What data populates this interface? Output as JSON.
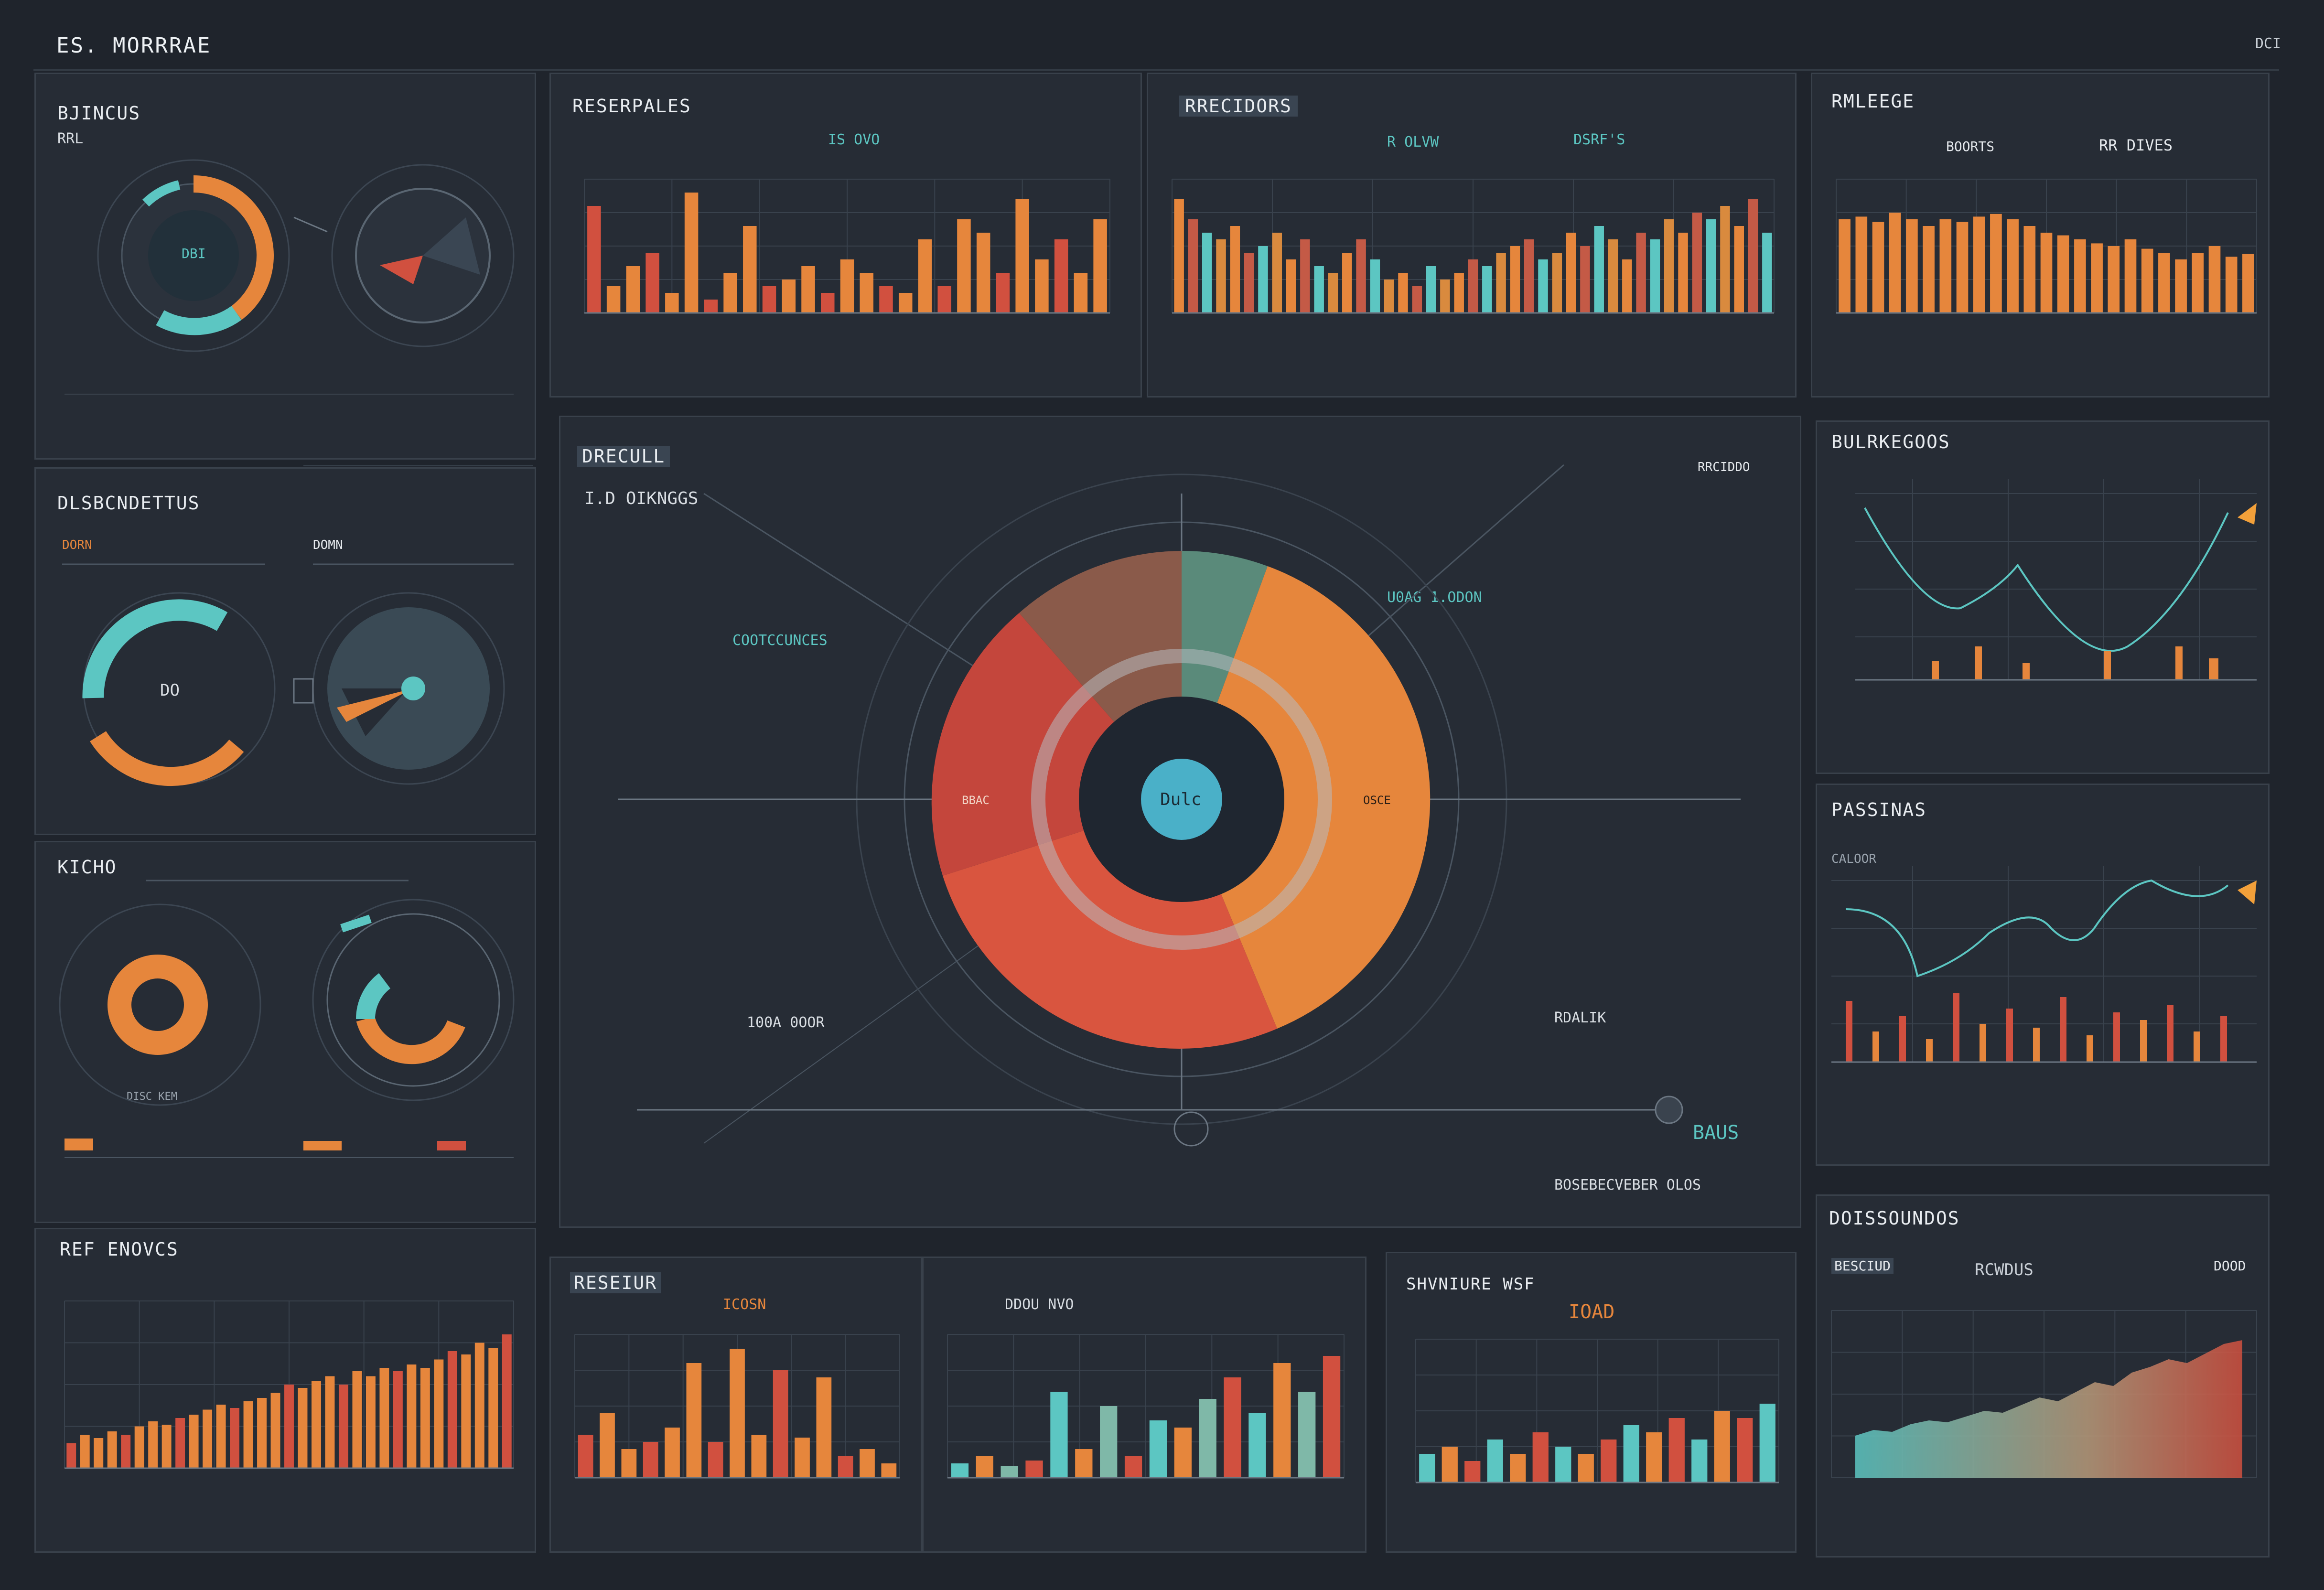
{
  "app": {
    "title": "ES. MORRRAE",
    "top_right": "DCI",
    "colors": {
      "bg": "#1f242c",
      "panel": "#262c35",
      "teal": "#5cc6c2",
      "orange": "#e6863c",
      "red": "#d1503f",
      "accent": "#f2a03a"
    }
  },
  "left": {
    "p1": {
      "title": "BJINCUS",
      "sub": "RRL"
    },
    "p2": {
      "title": "DLSBCNDETTUS",
      "row1": "DORN",
      "row2": "DOMN",
      "center": "DO"
    },
    "p3": {
      "title": "KICHO",
      "footer": "DISC KEM"
    },
    "p4": {
      "title": "REF ENOVCS"
    }
  },
  "top": {
    "p1": {
      "title": "RESERPALES",
      "stat": "IS OVO"
    },
    "p2": {
      "title": "RRECIDORS",
      "stat1": "R OLVW",
      "stat2": "DSRF'S"
    },
    "p3": {
      "title": "RMLEEGE",
      "stat1": "BOORTS",
      "stat2": "RR DIVES"
    }
  },
  "center": {
    "title": "DRECULL",
    "subtitle": "I.D OIKNGGS",
    "corner": "RRCIDDO",
    "hub": "Dulc",
    "label_left": "COOTCCUNCES",
    "label_right": "U0AG 1.ODON",
    "label_bl": "100A 0OOR",
    "label_br": "RDALIK",
    "slice_l": "BBAC",
    "slice_r": "OSCE",
    "footer": "BOSEBECVEBER OLOS",
    "badge": "BAUS"
  },
  "right": {
    "p1": {
      "title": "BULRKEGOOS"
    },
    "p2": {
      "title": "PASSINAS",
      "sub": "CALOOR"
    },
    "p3": {
      "title": "DOISSOUNDOS",
      "sub1": "BESCIUD",
      "sub2": "RCWDUS",
      "sub3": "DOOD"
    }
  },
  "bottom": {
    "p1": {
      "title": "RESEIUR",
      "stat": "ICOSN"
    },
    "p2": {
      "stat": "DDOU NVO"
    },
    "p3": {
      "title": "SHVNIURE WSF",
      "stat": "IOAD"
    }
  },
  "charts": {
    "top1_values": [
      80,
      20,
      35,
      45,
      15,
      90,
      10,
      30,
      65,
      20,
      25,
      35,
      15,
      40,
      30,
      20,
      15,
      55,
      20,
      70,
      60,
      30,
      85,
      40,
      55,
      30,
      70
    ],
    "top2_values": [
      85,
      70,
      60,
      55,
      65,
      45,
      50,
      60,
      40,
      55,
      35,
      30,
      45,
      55,
      40,
      25,
      30,
      20,
      35,
      25,
      30,
      40,
      35,
      45,
      50,
      55,
      40,
      45,
      60,
      50,
      65,
      55,
      40,
      60,
      55,
      70,
      60,
      75,
      70,
      80,
      65,
      85,
      60
    ],
    "top3_values": [
      70,
      72,
      68,
      75,
      70,
      65,
      70,
      68,
      72,
      74,
      70,
      65,
      60,
      58,
      55,
      52,
      50,
      55,
      48,
      45,
      40,
      45,
      50,
      42,
      44
    ],
    "bl_values": [
      15,
      20,
      18,
      22,
      20,
      25,
      28,
      26,
      30,
      32,
      35,
      38,
      36,
      40,
      42,
      45,
      50,
      48,
      52,
      55,
      50,
      58,
      55,
      60,
      58,
      62,
      60,
      65,
      70,
      68,
      75,
      72,
      80
    ],
    "b1_values": [
      30,
      45,
      20,
      25,
      35,
      80,
      25,
      90,
      30,
      75,
      28,
      70,
      15,
      20,
      10
    ],
    "b2_values": [
      10,
      15,
      8,
      12,
      60,
      20,
      50,
      15,
      40,
      35,
      55,
      70,
      45,
      80,
      60,
      85
    ],
    "b3_values": [
      20,
      25,
      15,
      30,
      20,
      35,
      25,
      20,
      30,
      40,
      35,
      45,
      30,
      50,
      45,
      55
    ],
    "area_values": [
      22,
      25,
      24,
      28,
      30,
      29,
      32,
      35,
      34,
      38,
      42,
      40,
      45,
      50,
      48,
      55,
      58,
      62,
      60,
      65,
      70,
      72
    ]
  }
}
